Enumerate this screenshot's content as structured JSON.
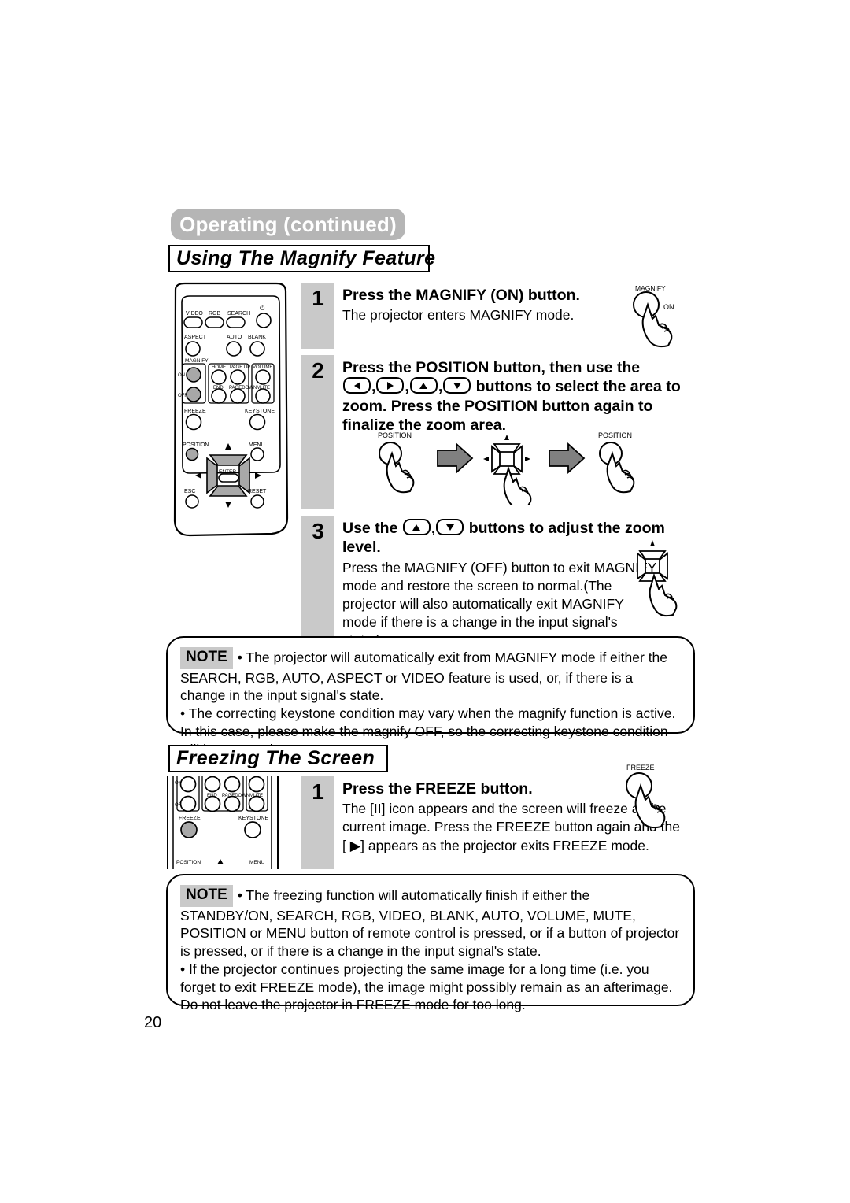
{
  "header": {
    "title": "Operating (continued)"
  },
  "page_number": "20",
  "sections": [
    {
      "id": "magnify",
      "title": "Using The Magnify Feature",
      "steps": [
        {
          "number": "1",
          "heading": "Press the MAGNIFY (ON) button.",
          "sub": "The projector enters MAGNIFY mode."
        },
        {
          "number": "2",
          "heading_part1": "Press the POSITION button, then use the",
          "heading_part2": " buttons to select the area to zoom. Press the POSITION button again to finalize the zoom area.",
          "comma": ",",
          "buttons": [
            "left-arrow-button",
            "right-arrow-button",
            "up-arrow-button",
            "down-arrow-button"
          ]
        },
        {
          "number": "3",
          "heading_part1": "Use the",
          "heading_part2": " buttons to adjust the zoom level.",
          "comma": ",",
          "buttons": [
            "up-arrow-button",
            "down-arrow-button"
          ],
          "sub": "Press the MAGNIFY (OFF) button to exit MAGNIFY mode and restore the screen to normal.(The projector will also automatically exit MAGNIFY mode if there is a change in the input signal's state.)"
        }
      ],
      "note": {
        "tag": "NOTE",
        "paragraphs": [
          "• The projector will automatically exit from MAGNIFY mode if either the SEARCH, RGB, AUTO, ASPECT or VIDEO feature is used, or, if there is a change in the input signal's state.",
          "• The correcting keystone condition may vary when the magnify function is active. In this case, please make the magnify OFF, so the correcting keystone condition will be restored."
        ]
      }
    },
    {
      "id": "freeze",
      "title": "Freezing The Screen",
      "steps": [
        {
          "number": "1",
          "heading": "Press the FREEZE button.",
          "sub": "The [II] icon appears and the screen will freeze at the current image. Press the FREEZE button again and the [ ▶] appears as the projector exits FREEZE mode."
        }
      ],
      "note": {
        "tag": "NOTE",
        "paragraphs": [
          "• The freezing function will automatically finish if either the STANDBY/ON, SEARCH, RGB, VIDEO, BLANK, AUTO, VOLUME, MUTE, POSITION or MENU button of remote control is pressed, or if a button of projector is pressed, or if there is a change in the input signal's state.",
          "• If the projector continues projecting the same image for a long time (i.e. you forget to exit FREEZE mode), the image might possibly remain as an afterimage. Do not leave the projector in FREEZE mode for too long."
        ]
      }
    }
  ],
  "remote_full": {
    "buttons": [
      "VIDEO",
      "RGB",
      "SEARCH",
      "ASPECT",
      "AUTO",
      "BLANK",
      "MAGNIFY",
      "ON",
      "OFF",
      "HOME",
      "PAGE UP",
      "VOLUME",
      "END",
      "PAGEDOWN",
      "MUTE",
      "FREEZE",
      "KEYSTONE",
      "POSITION",
      "MENU",
      "ENTER",
      "ESC",
      "RESET"
    ],
    "labels": {
      "video": "VIDEO",
      "rgb": "RGB",
      "search": "SEARCH",
      "aspect": "ASPECT",
      "auto": "AUTO",
      "blank": "BLANK",
      "magnify": "MAGNIFY",
      "on": "ON",
      "off": "OFF",
      "home": "HOME",
      "page_up": "PAGE UP",
      "volume": "VOLUME",
      "end": "END",
      "page_down": "PAGEDOWN",
      "mute": "MUTE",
      "freeze": "FREEZE",
      "keystone": "KEYSTONE",
      "position": "POSITION",
      "menu": "MENU",
      "enter": "ENTER",
      "esc": "ESC",
      "reset": "RESET"
    }
  },
  "illustrations": {
    "magnify_button": {
      "label_top": "MAGNIFY",
      "label_side": "ON"
    },
    "freeze_button": {
      "label_top": "FREEZE"
    },
    "position_flow": {
      "label_left": "POSITION",
      "label_right": "POSITION"
    }
  },
  "colors": {
    "header_gray": "#b5b5b5",
    "step_strip_gray": "#c9c9c9",
    "note_tag_gray": "#c9c9c9",
    "remote_key_gray": "#a8a8a8",
    "arrow_gray": "#808080",
    "ink": "#000000",
    "paper": "#ffffff"
  }
}
